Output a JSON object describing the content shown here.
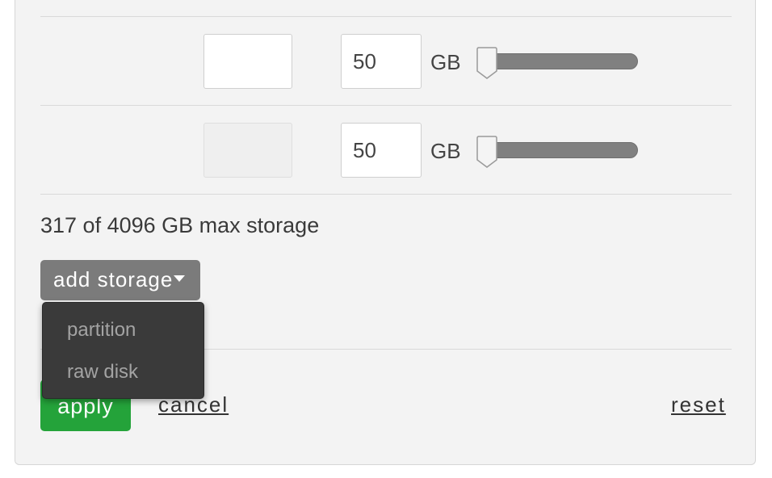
{
  "rows": [
    {
      "name_value": "",
      "size_value": "50",
      "unit": "GB",
      "slider_level": 0
    },
    {
      "name_value": "",
      "size_value": "50",
      "unit": "GB",
      "slider_level": 0
    }
  ],
  "storage_summary": "317 of 4096 GB max storage",
  "add_storage": {
    "label": "add storage",
    "menu": [
      "partition",
      "raw disk"
    ]
  },
  "actions": {
    "apply": "apply",
    "cancel": "cancel",
    "reset": "reset"
  },
  "colors": {
    "apply_green": "#24a33a",
    "button_gray": "#7b7b7b",
    "menu_bg": "#3a3a3a",
    "slider_fill": "#808080"
  }
}
